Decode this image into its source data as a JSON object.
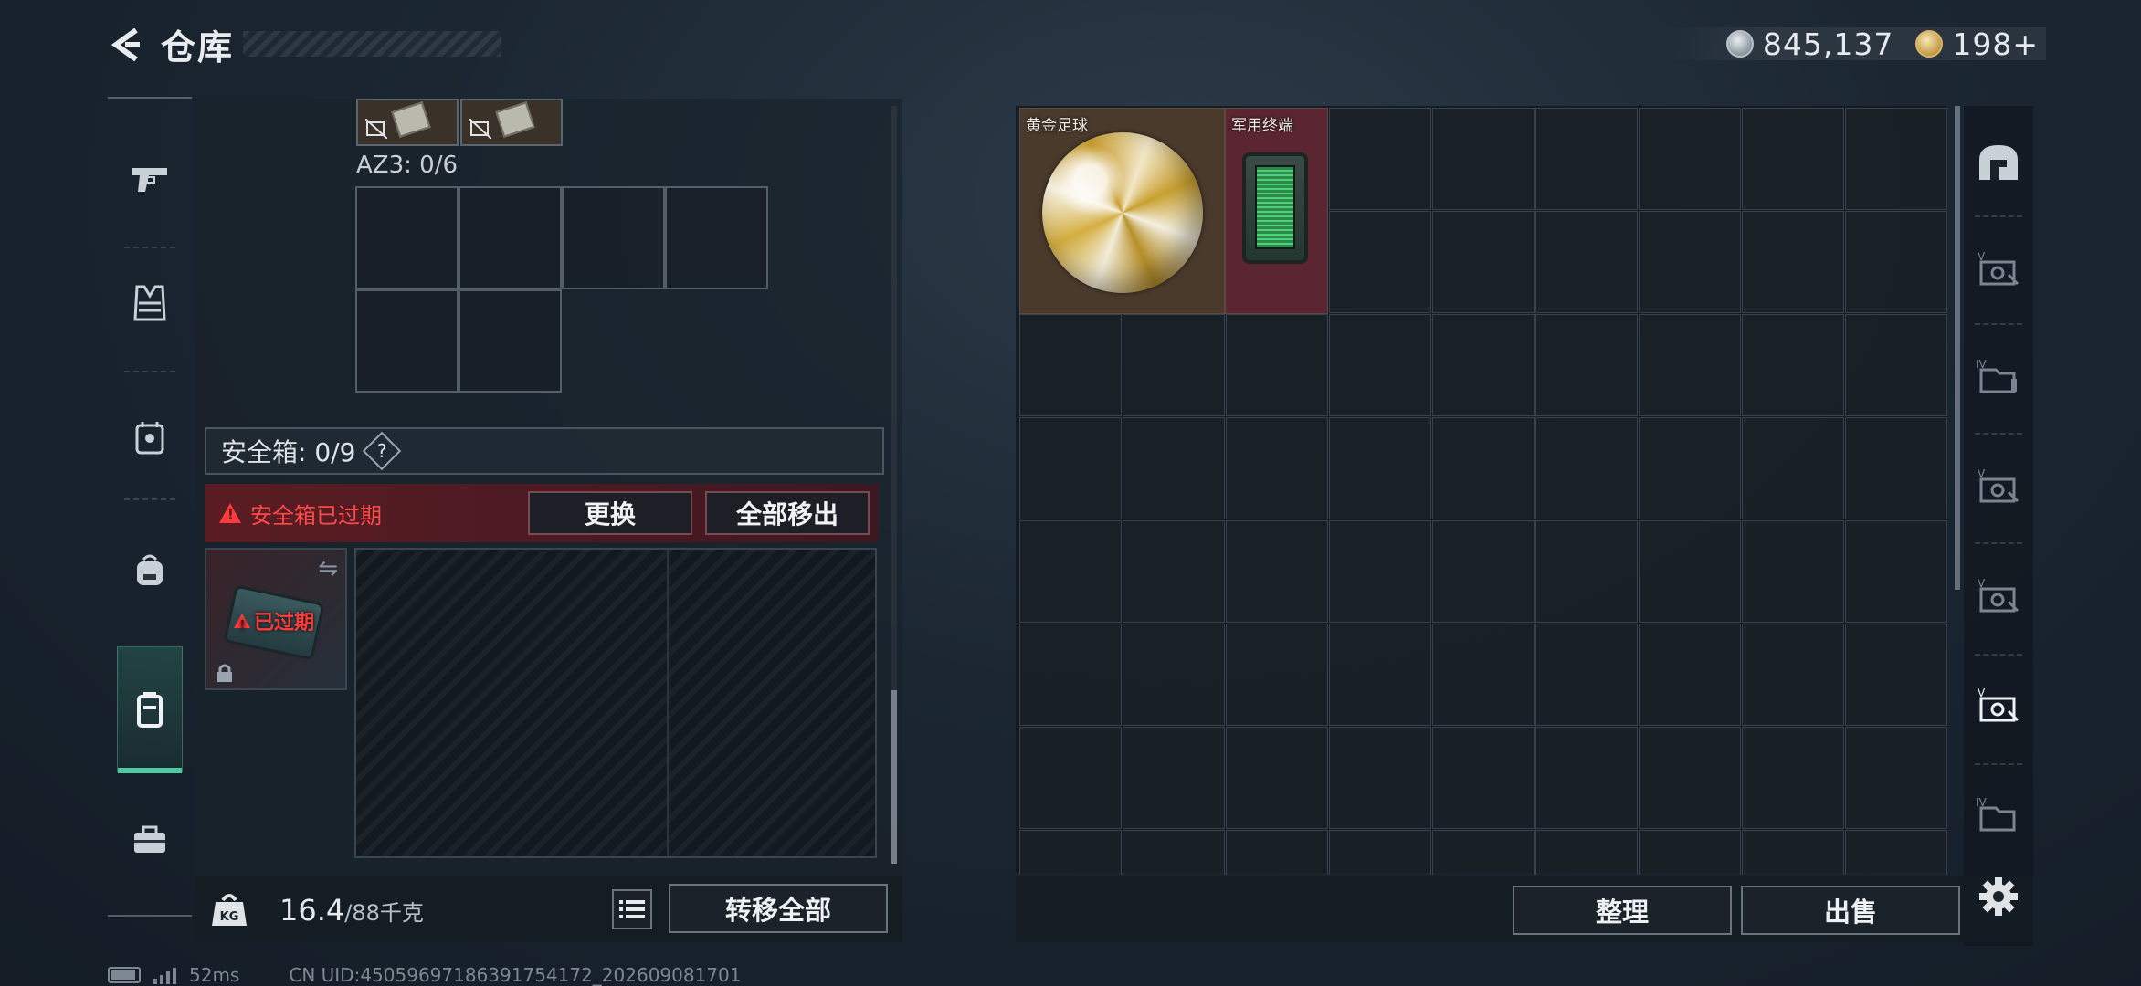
{
  "header": {
    "title": "仓库",
    "currencies": [
      {
        "icon": "silver-coin-icon",
        "value": "845,137"
      },
      {
        "icon": "gold-coin-icon",
        "value": "198+"
      }
    ]
  },
  "left_nav": {
    "items": [
      {
        "icon": "pistol-icon",
        "active": false
      },
      {
        "icon": "armor-vest-icon",
        "active": false
      },
      {
        "icon": "chest-rig-icon",
        "active": false
      },
      {
        "icon": "backpack-icon",
        "active": false
      },
      {
        "icon": "safe-case-icon",
        "active": true
      },
      {
        "icon": "briefcase-icon",
        "active": false
      }
    ]
  },
  "loadout": {
    "az3_label": "AZ3: 0/6",
    "safe_box_label": "安全箱: 0/9",
    "help_label": "?",
    "expired_banner": "安全箱已过期",
    "replace_button": "更换",
    "remove_all_button": "全部移出",
    "case_expired_label": "已过期",
    "swap_icon": "⇋"
  },
  "weight": {
    "current": "16.4",
    "max": "/88千克"
  },
  "left_bottom": {
    "transfer_all_button": "转移全部"
  },
  "stash": {
    "items": [
      {
        "name": "黄金足球",
        "bg": "#4a3a2c"
      },
      {
        "name": "军用终端",
        "bg": "#5b2631"
      }
    ]
  },
  "right_bottom": {
    "organize_button": "整理",
    "sell_button": "出售"
  },
  "right_nav": {
    "items": [
      {
        "icon": "stash-home-icon",
        "badge": ""
      },
      {
        "icon": "case-v-icon",
        "badge": "V"
      },
      {
        "icon": "case-iv-icon",
        "badge": "IV"
      },
      {
        "icon": "case-v-icon",
        "badge": "V"
      },
      {
        "icon": "case-v-icon",
        "badge": "V"
      },
      {
        "icon": "case-v-active-icon",
        "badge": "V"
      },
      {
        "icon": "case-iv-icon",
        "badge": "IV"
      }
    ]
  },
  "status": {
    "ping": "52ms",
    "uid": "CN UID:4505969718639175417​2_202609081701"
  },
  "colors": {
    "accent_green": "#4ec9a0",
    "warning_red": "#ff3a3a",
    "expired_bg": "#5a1c22"
  }
}
